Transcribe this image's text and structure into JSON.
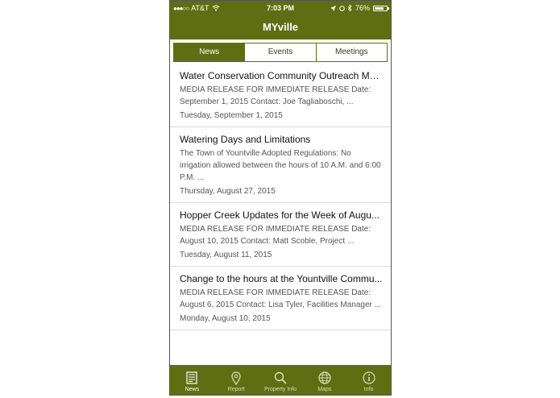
{
  "status_bar": {
    "carrier": "AT&T",
    "time": "7:03 PM",
    "battery": "76%",
    "battery_level": 0.76
  },
  "app": {
    "title": "MYville"
  },
  "segments": [
    {
      "label": "News",
      "active": true
    },
    {
      "label": "Events",
      "active": false
    },
    {
      "label": "Meetings",
      "active": false
    }
  ],
  "news": [
    {
      "title": "Water Conservation Community Outreach Me...",
      "summary": "MEDIA RELEASE FOR IMMEDIATE RELEASE Date: September 1, 2015 Contact: Joe Tagliaboschi, ...",
      "date": "Tuesday, September 1, 2015"
    },
    {
      "title": "Watering Days and Limitations",
      "summary": "The Town of Yountville Adopted Regulations: No irrigation allowed between the hours of 10 A.M. and 6:00 P.M. ...",
      "date": "Thursday, August 27, 2015"
    },
    {
      "title": "Hopper Creek Updates for the Week of Augu...",
      "summary": "MEDIA RELEASE FOR IMMEDIATE RELEASE Date: August 10, 2015 Contact: Matt Scoble, Project ...",
      "date": "Tuesday, August 11, 2015"
    },
    {
      "title": "Change to the hours at the Yountville Commu...",
      "summary": "MEDIA RELEASE FOR IMMEDIATE RELEASE Date: August 6, 2015 Contact: Lisa Tyler, Facilities Manager ...",
      "date": "Monday, August 10, 2015"
    }
  ],
  "tab_bar": [
    {
      "label": "News",
      "icon": "news-icon",
      "active": true
    },
    {
      "label": "Report",
      "icon": "map-pin-icon",
      "active": false
    },
    {
      "label": "Property Info",
      "icon": "search-icon",
      "active": false
    },
    {
      "label": "Maps",
      "icon": "globe-icon",
      "active": false
    },
    {
      "label": "Info",
      "icon": "info-icon",
      "active": false
    }
  ],
  "colors": {
    "brand": "#5f6e12",
    "tab_inactive": "#d9dfb8"
  }
}
